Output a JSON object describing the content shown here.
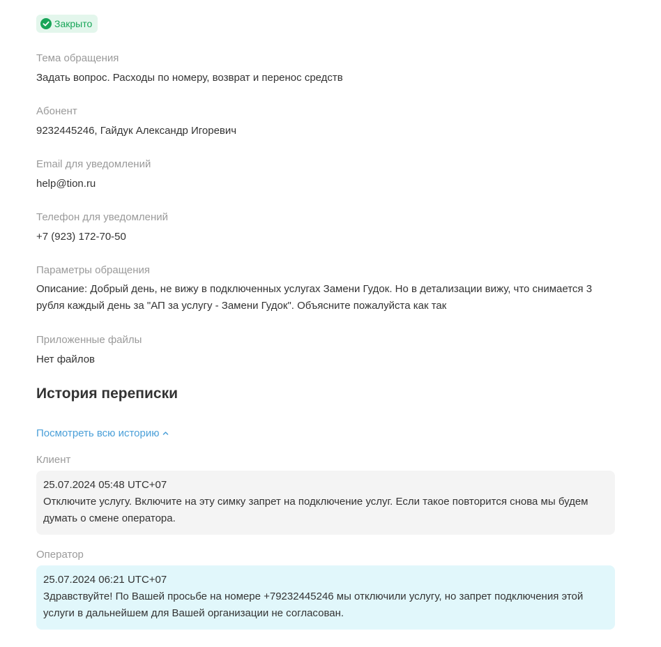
{
  "status": {
    "label": "Закрыто",
    "icon": "check-circle-icon",
    "color": "#18a558",
    "background": "#e3f6ec"
  },
  "fields": {
    "topic": {
      "label": "Тема обращения",
      "value": "Задать вопрос. Расходы по номеру, возврат и перенос средств"
    },
    "subscriber": {
      "label": "Абонент",
      "value": "9232445246, Гайдук Александр Игоревич"
    },
    "email": {
      "label": "Email для уведомлений",
      "value": "help@tion.ru"
    },
    "phone": {
      "label": "Телефон для уведомлений",
      "value": "+7 (923) 172-70-50"
    },
    "params": {
      "label": "Параметры обращения",
      "value": "Описание: Добрый день, не вижу в подключенных услугах Замени Гудок. Но в детализации вижу, что снимается 3 рубля каждый день за \"АП за услугу - Замени Гудок\". Объясните пожалуйста как так"
    },
    "files": {
      "label": "Приложенные файлы",
      "value": "Нет файлов"
    }
  },
  "history": {
    "title": "История переписки",
    "toggle_label": "Посмотреть всю историю",
    "toggle_icon": "chevron-up-icon",
    "link_color": "#4a9fd8",
    "messages": [
      {
        "role": "Клиент",
        "timestamp": "25.07.2024 05:48 UTC+07",
        "text": "Отключите услугу. Включите на эту симку запрет на подключение услуг. Если такое повторится снова мы будем думать о смене оператора.",
        "background": "#f4f4f4"
      },
      {
        "role": "Оператор",
        "timestamp": "25.07.2024 06:21 UTC+07",
        "text": "Здравствуйте!  По Вашей просьбе на номере +79232445246 мы отключили услугу, но запрет подключения этой услуги в дальнейшем для Вашей организации не согласован.",
        "background": "#e1f7fb"
      }
    ]
  }
}
